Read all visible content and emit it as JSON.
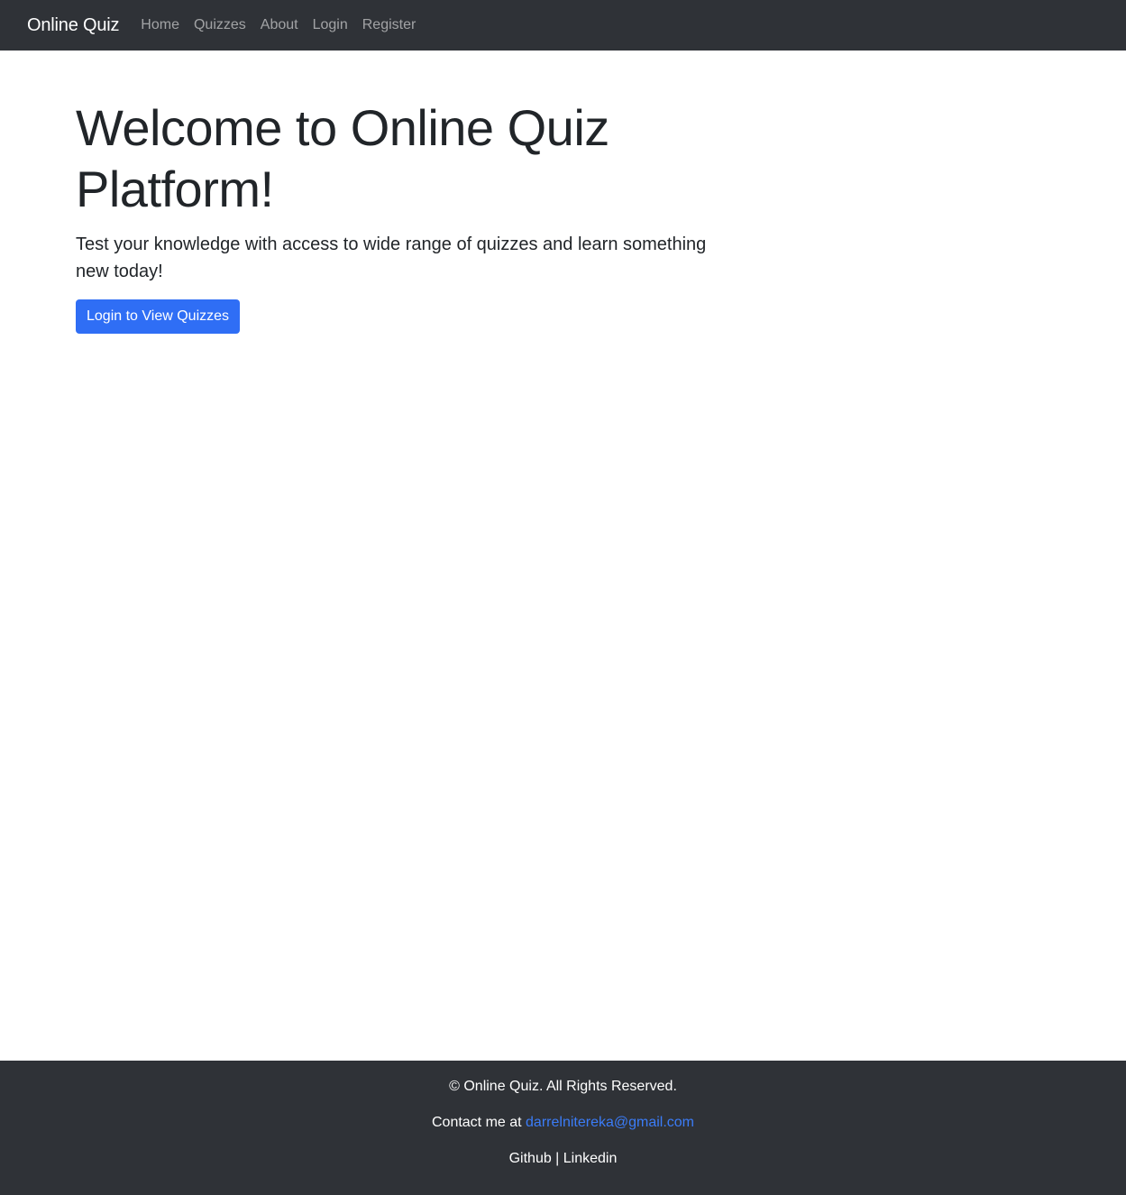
{
  "navbar": {
    "brand": "Online Quiz",
    "links": [
      {
        "label": "Home"
      },
      {
        "label": "Quizzes"
      },
      {
        "label": "About"
      },
      {
        "label": "Login"
      },
      {
        "label": "Register"
      }
    ]
  },
  "hero": {
    "title": "Welcome to Online Quiz Platform!",
    "lead": "Test your knowledge with access to wide range of quizzes and learn something new today!",
    "button_label": "Login to View Quizzes"
  },
  "footer": {
    "copyright": "© Online Quiz. All Rights Reserved.",
    "contact_prefix": "Contact me at ",
    "email": "darrelnitereka@gmail.com",
    "github": "Github",
    "separator": " | ",
    "linkedin": "Linkedin"
  },
  "colors": {
    "navbar_bg": "#2f3237",
    "primary": "#2f6ef5",
    "link": "#3b7cf7"
  }
}
